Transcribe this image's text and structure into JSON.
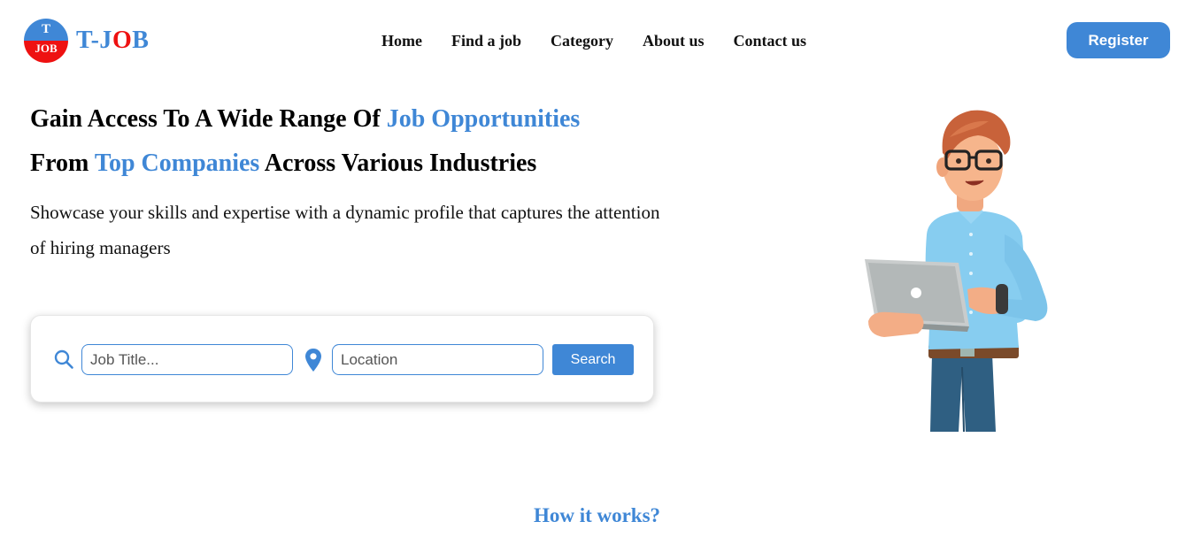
{
  "header": {
    "logo": {
      "badge_top": "T",
      "badge_bottom": "JOB",
      "text_prefix": "T-J",
      "text_red": "O",
      "text_suffix": "B"
    },
    "nav": [
      "Home",
      "Find a job",
      "Category",
      "About us",
      "Contact us"
    ],
    "register_label": "Register"
  },
  "hero": {
    "line1_start": "Gain Access To A Wide Range Of ",
    "line1_highlight": "Job Opportunities",
    "line2_start": "From ",
    "line2_highlight": "Top Companies",
    "line2_end": " Across Various Industries",
    "subtext": "Showcase your skills and expertise with a dynamic profile that captures the attention of hiring managers"
  },
  "search": {
    "job_placeholder": "Job Title...",
    "location_placeholder": "Location",
    "button_label": "Search",
    "icons": [
      "search-icon",
      "location-pin-icon"
    ]
  },
  "section": {
    "how_title": "How it works?"
  },
  "colors": {
    "accent": "#3f87d6",
    "logo_red": "#ee1111"
  }
}
